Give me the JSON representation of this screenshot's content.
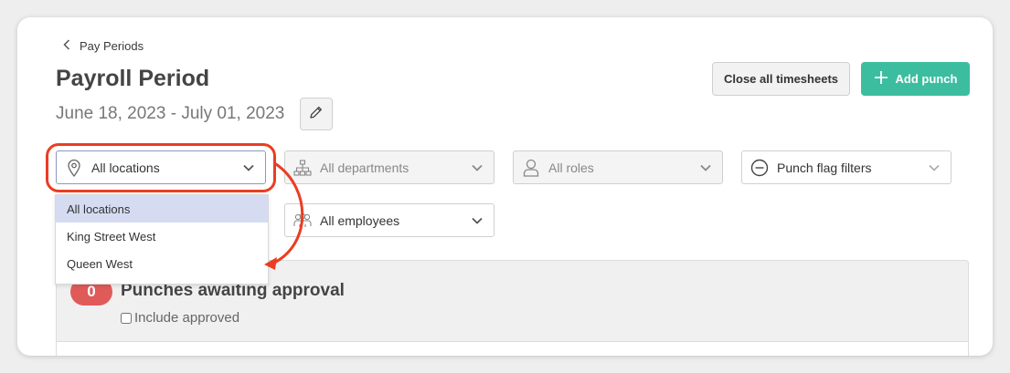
{
  "header": {
    "back_label": "Pay Periods",
    "title": "Payroll Period",
    "date_range": "June 18, 2023 - July 01, 2023"
  },
  "actions": {
    "close_all": "Close all timesheets",
    "add_punch": "Add punch"
  },
  "filters": {
    "location": {
      "value": "All locations",
      "icon": "map-pin-icon"
    },
    "department": {
      "value": "All departments",
      "icon": "org-chart-icon"
    },
    "role": {
      "value": "All roles",
      "icon": "person-icon"
    },
    "punch_flag": {
      "value": "Punch flag filters",
      "icon": "minus-circle-icon"
    },
    "employees": {
      "value": "All employees",
      "icon": "people-icon"
    }
  },
  "location_dropdown": {
    "options": [
      "All locations",
      "King Street West",
      "Queen West"
    ],
    "selected": "All locations"
  },
  "approval_panel": {
    "count": "0",
    "title": "Punches awaiting approval",
    "include_approved": "Include approved"
  },
  "colors": {
    "accent": "#3dbda0",
    "badge": "#e05a5a",
    "selected_option": "#d5dcf2",
    "annotation": "#ea3d24"
  }
}
